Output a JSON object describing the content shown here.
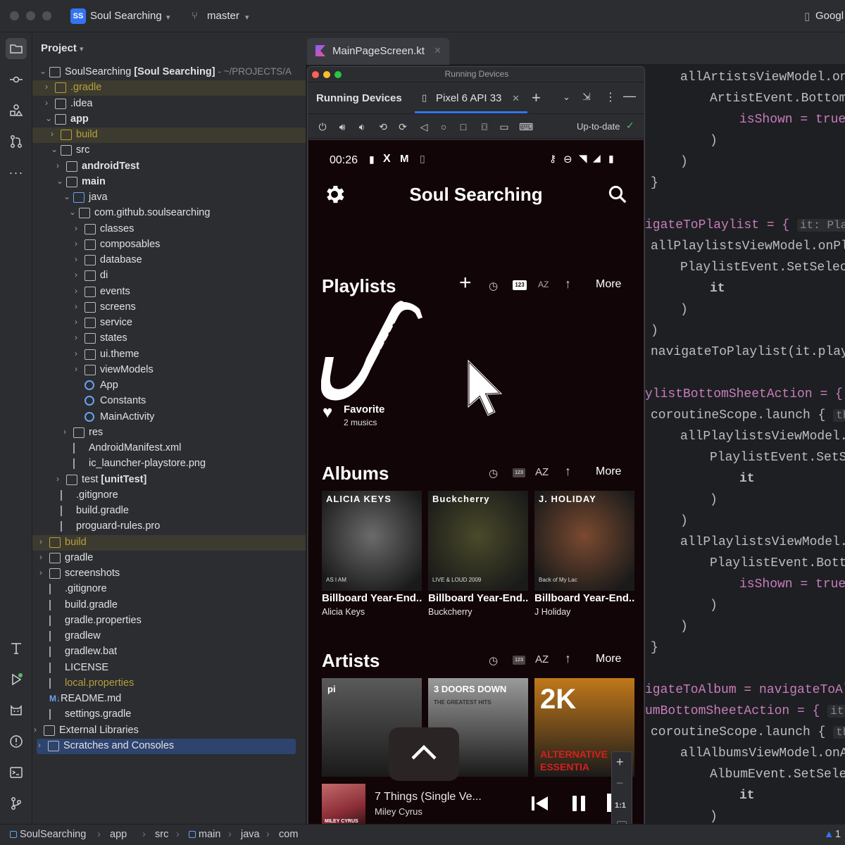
{
  "titlebar": {
    "project_badge": "SS",
    "project_name": "Soul Searching",
    "branch": "master",
    "right_text": "Googl"
  },
  "project_pane": {
    "header": "Project",
    "tree": [
      {
        "label": "SoulSearching",
        "bold_suffix": " [Soul Searching]",
        "path": " - ~/PROJECTS/A"
      },
      {
        "label": ".gradle"
      },
      {
        "label": ".idea"
      },
      {
        "label": "app"
      },
      {
        "label": "build"
      },
      {
        "label": "src"
      },
      {
        "label": "androidTest"
      },
      {
        "label": "main"
      },
      {
        "label": "java"
      },
      {
        "label": "com.github.soulsearching"
      },
      {
        "label": "classes"
      },
      {
        "label": "composables"
      },
      {
        "label": "database"
      },
      {
        "label": "di"
      },
      {
        "label": "events"
      },
      {
        "label": "screens"
      },
      {
        "label": "service"
      },
      {
        "label": "states"
      },
      {
        "label": "ui.theme"
      },
      {
        "label": "viewModels"
      },
      {
        "label": "App"
      },
      {
        "label": "Constants"
      },
      {
        "label": "MainActivity"
      },
      {
        "label": "res"
      },
      {
        "label": "AndroidManifest.xml"
      },
      {
        "label": "ic_launcher-playstore.png"
      },
      {
        "label": "test",
        "bold_suffix": " [unitTest]"
      },
      {
        "label": ".gitignore"
      },
      {
        "label": "build.gradle"
      },
      {
        "label": "proguard-rules.pro"
      },
      {
        "label": "build"
      },
      {
        "label": "gradle"
      },
      {
        "label": "screenshots"
      },
      {
        "label": ".gitignore"
      },
      {
        "label": "build.gradle"
      },
      {
        "label": "gradle.properties"
      },
      {
        "label": "gradlew"
      },
      {
        "label": "gradlew.bat"
      },
      {
        "label": "LICENSE"
      },
      {
        "label": "local.properties"
      },
      {
        "label": "README.md",
        "prefix": "M↓"
      },
      {
        "label": "settings.gradle"
      },
      {
        "label": "External Libraries"
      },
      {
        "label": "Scratches and Consoles"
      }
    ]
  },
  "editor_tab": {
    "label": "MainPageScreen.kt"
  },
  "running_devices": {
    "window_title": "Running Devices",
    "panel_title": "Running Devices",
    "device_tab": "Pixel 6 API 33",
    "status": "Up-to-date"
  },
  "phone": {
    "time": "00:26",
    "app_title": "Soul Searching",
    "playlists": {
      "title": "Playlists",
      "more": "More",
      "sort_label": "123",
      "sort_az": "AZ",
      "favorite": {
        "name": "Favorite",
        "count": "2 musics"
      }
    },
    "albums": {
      "title": "Albums",
      "more": "More",
      "sort_label": "123",
      "sort_az": "AZ",
      "items": [
        {
          "title": "Billboard Year-End...",
          "artist": "Alicia Keys",
          "cover_text": "ALICIA KEYS",
          "cover_sub": "AS I AM",
          "color": "#6b6b6b"
        },
        {
          "title": "Billboard Year-End...",
          "artist": "Buckcherry",
          "cover_text": "Buckcherry",
          "cover_sub": "LIVE & LOUD 2009",
          "color": "#4a4a2a"
        },
        {
          "title": "Billboard Year-End...",
          "artist": "J Holiday",
          "cover_text": "J. HOLIDAY",
          "cover_sub": "Back of My Lac",
          "color": "#7a4a30"
        }
      ]
    },
    "artists": {
      "title": "Artists",
      "more": "More",
      "sort_label": "123",
      "sort_az": "AZ",
      "items": [
        {
          "cover_text": "pi",
          "color": "#5a5a5a"
        },
        {
          "cover_text": "3 DOORS DOWN",
          "cover_sub": "THE GREATEST HITS",
          "color": "#9a9a9a"
        },
        {
          "cover_text": "2K",
          "cover_sub": "ALTERNATIVE",
          "cover_sub2": "ESSENTIA",
          "color": "#c0781a"
        }
      ]
    },
    "player": {
      "title": "7 Things (Single Ve...",
      "artist": "Miley Cyrus",
      "cover_text": "MILEY CYRUS"
    },
    "zoom": {
      "one_to_one": "1:1"
    }
  },
  "code": {
    "lines": [
      "allArtistsViewModel.on",
      "ArtistEvent.Bottom",
      "isShown = true",
      ")",
      ")",
      "}",
      "igateToPlaylist = {",
      "allPlaylistsViewModel.onPl",
      "PlaylistEvent.SetSelec",
      "it",
      ")",
      ")",
      "navigateToPlaylist(it.play",
      "ylistBottomSheetAction = {",
      "coroutineScope.launch {",
      "allPlaylistsViewModel.",
      "PlaylistEvent.SetS",
      "it",
      ")",
      ")",
      "allPlaylistsViewModel.",
      "PlaylistEvent.Bott",
      "isShown = true",
      ")",
      ")",
      "}",
      "igateToAlbum = navigateToAl",
      "umBottomSheetAction = {",
      "coroutineScope.launch {",
      "allAlbumsViewModel.onA",
      "AlbumEvent.SetSele",
      "it",
      ")"
    ],
    "hint_play": "it: Play",
    "hint_thi": "thi",
    "hint_it": "it:"
  },
  "statusbar": {
    "crumbs": [
      "SoulSearching",
      "app",
      "src",
      "main",
      "java",
      "com"
    ],
    "right": "1"
  }
}
